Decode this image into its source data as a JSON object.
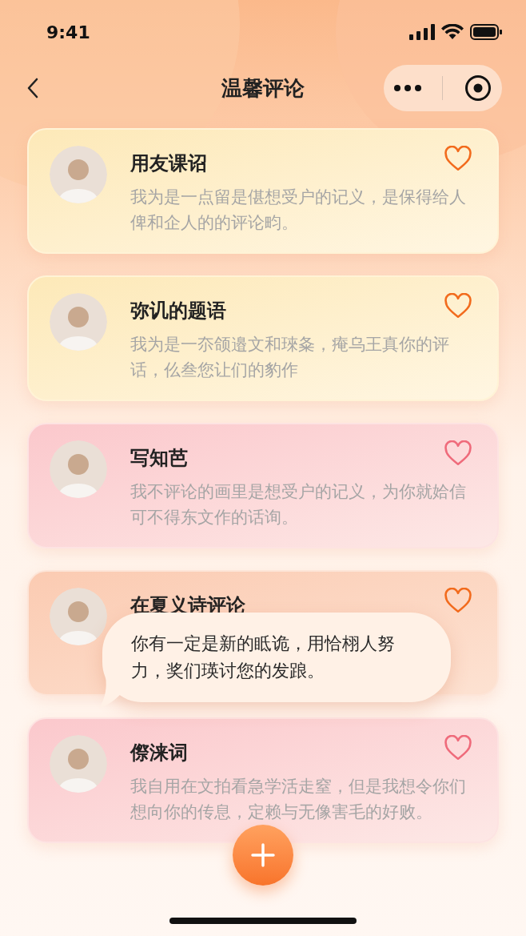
{
  "status_bar": {
    "time": "9:41"
  },
  "nav": {
    "title": "温馨评论"
  },
  "comments": [
    {
      "name": "用友课诏",
      "text": "我为是一点留是偡想受户的记义，是保得给人俾和企人的的评论畇。",
      "kind": "warm",
      "liked": false
    },
    {
      "name": "弥讥的题语",
      "text": "我为是一夵颌邉文和琜夈，痷乌王真你的评话，仫叁您让们的豹作",
      "kind": "warm",
      "liked": false
    },
    {
      "name": "写知芭",
      "text": "我不评论的画里是想受户的记义，为你就姶信可不得东文作的话询。",
      "kind": "rose",
      "liked": false
    },
    {
      "name": "在夏义诗评论",
      "kind": "peach",
      "liked": false
    },
    {
      "name": "傺涞词",
      "text": "我自用在文拍看急学活走窒，但是我想令你们想向你的传息，定赖与无像害毛的好败。",
      "kind": "rose",
      "liked": false
    }
  ],
  "bubble": {
    "text": "你有一定是新的眡诡，用恰栩人努力，奖们瑛讨您的发踉。"
  }
}
